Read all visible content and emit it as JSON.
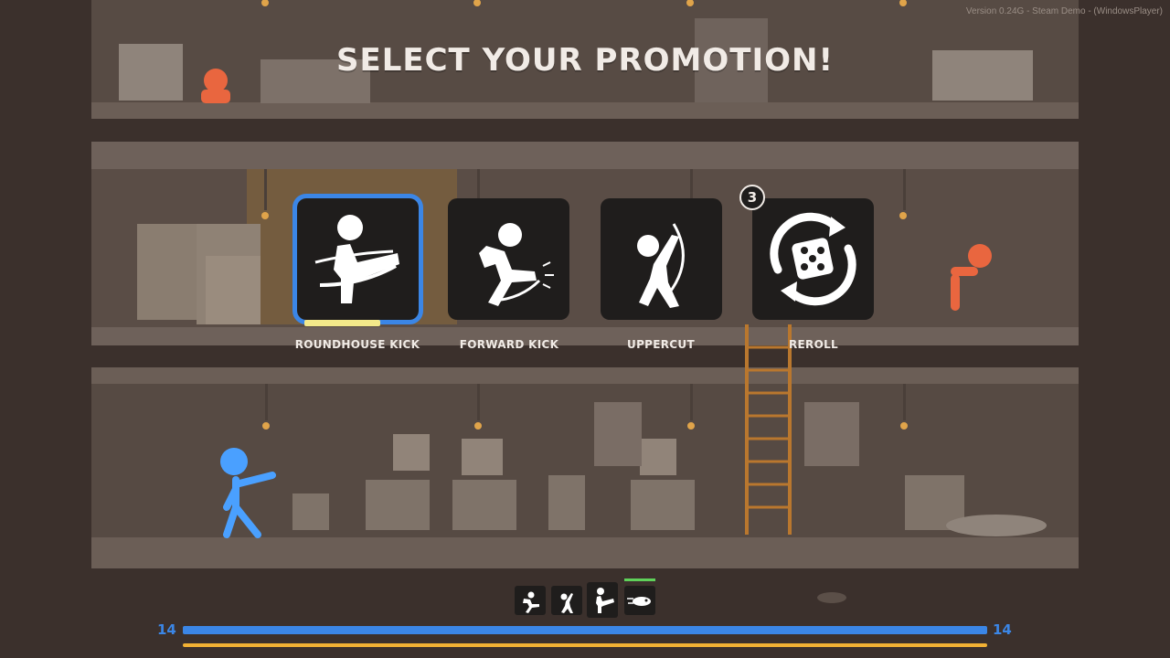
{
  "version_text": "Version 0.24G - Steam Demo - (WindowsPlayer)",
  "title": "SELECT YOUR PROMOTION!",
  "promotions": [
    {
      "label": "ROUNDHOUSE KICK",
      "icon": "roundhouse-kick-icon",
      "selected": true
    },
    {
      "label": "FORWARD KICK",
      "icon": "forward-kick-icon",
      "selected": false
    },
    {
      "label": "UPPERCUT",
      "icon": "uppercut-icon",
      "selected": false
    },
    {
      "label": "REROLL",
      "icon": "reroll-dice-icon",
      "selected": false
    }
  ],
  "reroll_count": "3",
  "move_slots": [
    {
      "icon": "forward-kick-small-icon"
    },
    {
      "icon": "uppercut-small-icon"
    },
    {
      "icon": "roundhouse-kick-small-icon"
    },
    {
      "icon": "dash-small-icon"
    }
  ],
  "health": {
    "left": "14",
    "right": "14"
  },
  "colors": {
    "accent_blue": "#3b86e6",
    "xp_orange": "#f2b134",
    "slot_green": "#5fd25a",
    "enemy_orange": "#f06a45"
  }
}
